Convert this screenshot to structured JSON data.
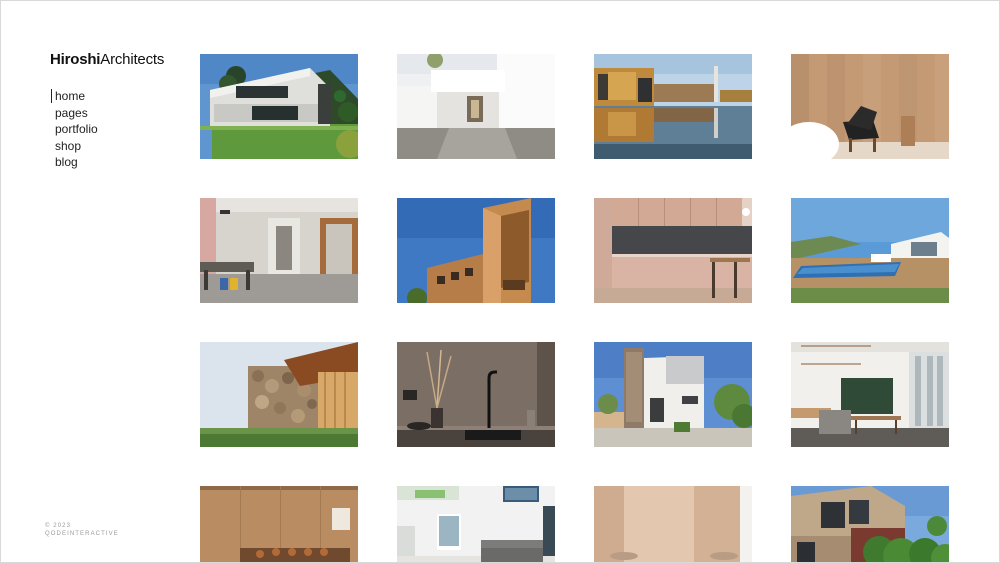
{
  "brand": {
    "name_bold": "Hiroshi",
    "name_light": "Architects"
  },
  "nav": {
    "items": [
      {
        "label": "home",
        "active": true
      },
      {
        "label": "pages",
        "active": false
      },
      {
        "label": "portfolio",
        "active": false
      },
      {
        "label": "shop",
        "active": false
      },
      {
        "label": "blog",
        "active": false
      }
    ]
  },
  "footer": {
    "line1": "© 2023",
    "line2": "QODEINTERACTIVE"
  },
  "gallery": {
    "items": [
      {
        "subject": "modern concrete house on lawn"
      },
      {
        "subject": "white minimal entrance courtyard"
      },
      {
        "subject": "waterfront townhouses reflection"
      },
      {
        "subject": "wood panel interior with chair"
      },
      {
        "subject": "concrete interior with dining table"
      },
      {
        "subject": "timber clad tower facade"
      },
      {
        "subject": "pink minimal kitchen"
      },
      {
        "subject": "villa with swimming pool"
      },
      {
        "subject": "stone wall with wooden canopy"
      },
      {
        "subject": "dark kitchen sink with faucet"
      },
      {
        "subject": "white modern house with courtyard"
      },
      {
        "subject": "open plan interior with green wall"
      },
      {
        "subject": "wooden boardroom"
      },
      {
        "subject": "white living room with sofa"
      },
      {
        "subject": "beige wall interior"
      },
      {
        "subject": "brick house with hedge"
      }
    ]
  },
  "colors": {
    "text": "#111111",
    "muted": "#9a9a9a",
    "border": "#d9d9d9",
    "background": "#ffffff"
  }
}
